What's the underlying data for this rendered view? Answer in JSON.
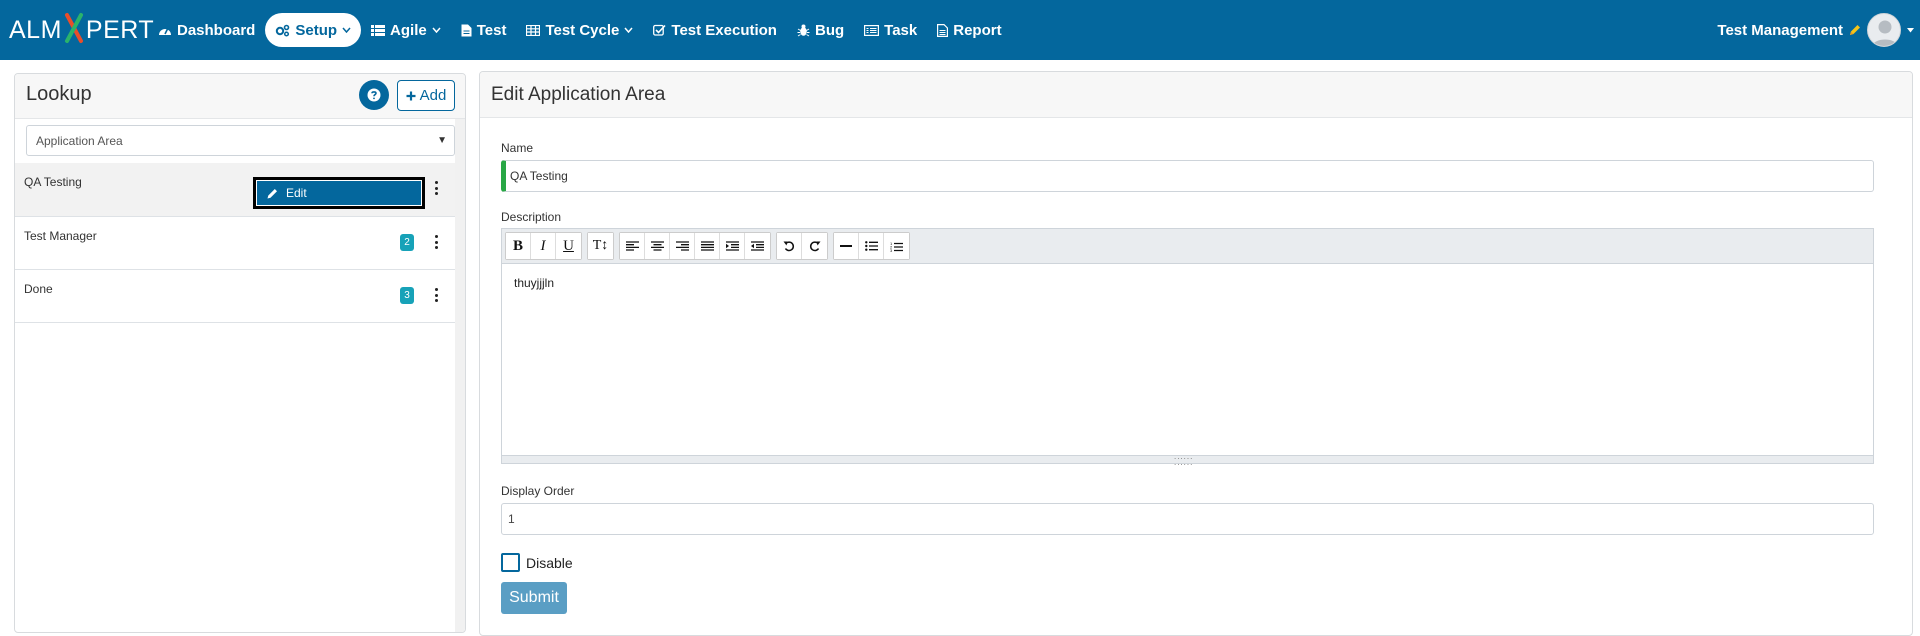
{
  "app": {
    "logo_left": "ALM",
    "logo_right": "PERT",
    "accent": "#04679d"
  },
  "nav": {
    "items": [
      {
        "label": "Dashboard",
        "icon": "dashboard-icon"
      },
      {
        "label": "Setup",
        "icon": "cogs-icon",
        "active": true,
        "dropdown": true
      },
      {
        "label": "Agile",
        "icon": "list-icon",
        "dropdown": true
      },
      {
        "label": "Test",
        "icon": "file-icon"
      },
      {
        "label": "Test Cycle",
        "icon": "table-icon",
        "dropdown": true
      },
      {
        "label": "Test Execution",
        "icon": "checkbox-icon"
      },
      {
        "label": "Bug",
        "icon": "bug-icon"
      },
      {
        "label": "Task",
        "icon": "task-icon"
      },
      {
        "label": "Report",
        "icon": "report-icon"
      }
    ],
    "user": "Test Management"
  },
  "lookup": {
    "title": "Lookup",
    "add_label": "Add",
    "select_value": "Application Area",
    "items": [
      {
        "label": "QA Testing",
        "badge": "",
        "selected": true
      },
      {
        "label": "Test Manager",
        "badge": "2"
      },
      {
        "label": "Done",
        "badge": "3"
      }
    ],
    "edit_label": "Edit"
  },
  "form": {
    "title": "Edit Application Area",
    "name_label": "Name",
    "name_value": "QA Testing",
    "description_label": "Description",
    "description_value": "thuyjjjln",
    "toolbar": [
      "B",
      "I",
      "U",
      "T↕",
      "align-left",
      "align-center",
      "align-right",
      "justify",
      "indent",
      "outdent",
      "undo",
      "redo",
      "hr",
      "ul",
      "ol"
    ],
    "order_label": "Display Order",
    "order_value": "1",
    "disable_label": "Disable",
    "submit_label": "Submit"
  }
}
